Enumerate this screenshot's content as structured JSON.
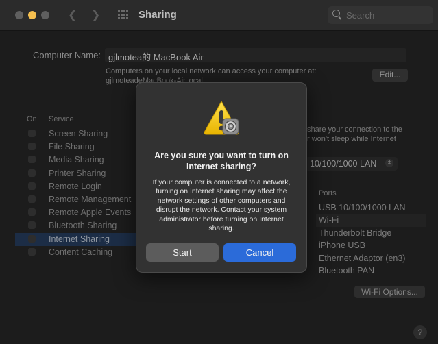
{
  "window": {
    "title": "Sharing",
    "search_placeholder": "Search"
  },
  "computer_name": {
    "label": "Computer Name:",
    "value": "gjlmotea的 MacBook Air",
    "note_line1": "Computers on your local network can access your computer at:",
    "note_line2": "gjlmoteadeMacBook-Air.local",
    "edit_label": "Edit..."
  },
  "services": {
    "header_on": "On",
    "header_service": "Service",
    "items": [
      {
        "label": "Screen Sharing"
      },
      {
        "label": "File Sharing"
      },
      {
        "label": "Media Sharing"
      },
      {
        "label": "Printer Sharing"
      },
      {
        "label": "Remote Login"
      },
      {
        "label": "Remote Management"
      },
      {
        "label": "Remote Apple Events"
      },
      {
        "label": "Bluetooth Sharing"
      },
      {
        "label": "Internet Sharing"
      },
      {
        "label": "Content Caching"
      }
    ],
    "selected": "Internet Sharing"
  },
  "detail": {
    "note_line1": "share your connection to the",
    "note_line2": "r won't sleep while Internet",
    "connection_value": "10/100/1000 LAN",
    "ports_header": "Ports",
    "ports": [
      {
        "label": "USB 10/100/1000 LAN"
      },
      {
        "label": "Wi-Fi"
      },
      {
        "label": "Thunderbolt Bridge"
      },
      {
        "label": "iPhone USB"
      },
      {
        "label": "Ethernet Adaptor (en3)"
      },
      {
        "label": "Bluetooth PAN"
      }
    ],
    "wifi_options_label": "Wi-Fi Options...",
    "help_label": "?"
  },
  "dialog": {
    "title": "Are you sure you want to turn on Internet sharing?",
    "message": "If your computer is connected to a network, turning on Internet sharing may affect the network settings of other computers and disrupt the network. Contact your system administrator before turning on Internet sharing.",
    "start_label": "Start",
    "cancel_label": "Cancel",
    "icon": "warning-icon",
    "accent_color": "#2b6bd9"
  }
}
